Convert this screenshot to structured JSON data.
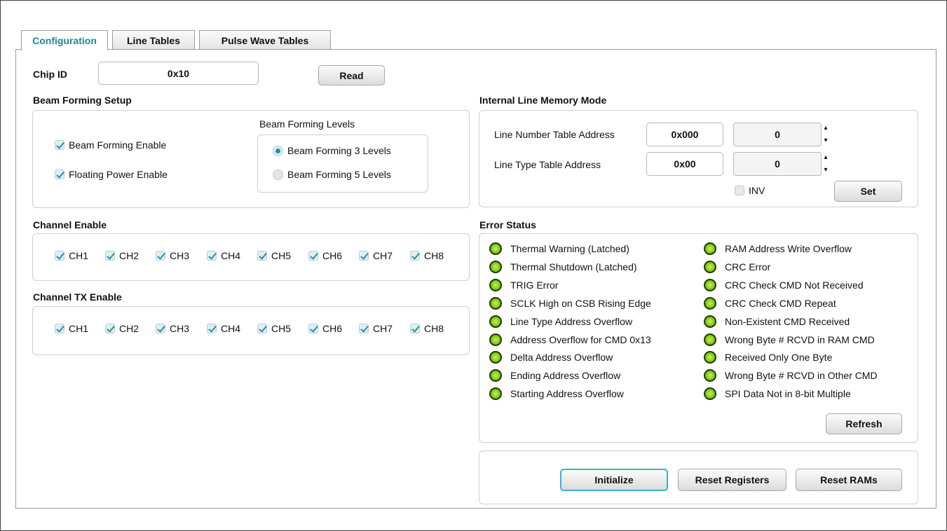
{
  "tabs": [
    {
      "label": "Configuration",
      "active": true
    },
    {
      "label": "Line Tables",
      "active": false
    },
    {
      "label": "Pulse Wave Tables",
      "active": false
    }
  ],
  "chip_id": {
    "label": "Chip ID",
    "value": "0x10",
    "read_button": "Read"
  },
  "beam_forming": {
    "title": "Beam Forming Setup",
    "enable_label": "Beam Forming Enable",
    "enable_checked": true,
    "floating_label": "Floating Power Enable",
    "floating_checked": true,
    "levels_title": "Beam Forming Levels",
    "level3_label": "Beam Forming 3 Levels",
    "level5_label": "Beam Forming 5 Levels",
    "selected_level": "3"
  },
  "channel_enable": {
    "title": "Channel Enable",
    "channels": [
      "CH1",
      "CH2",
      "CH3",
      "CH4",
      "CH5",
      "CH6",
      "CH7",
      "CH8"
    ]
  },
  "channel_tx_enable": {
    "title": "Channel TX Enable",
    "channels": [
      "CH1",
      "CH2",
      "CH3",
      "CH4",
      "CH5",
      "CH6",
      "CH7",
      "CH8"
    ]
  },
  "line_memory": {
    "title": "Internal Line Memory Mode",
    "line_number_label": "Line Number Table Address",
    "line_number_value": "0x000",
    "line_number_spin": "0",
    "line_type_label": "Line Type Table Address",
    "line_type_value": "0x00",
    "line_type_spin": "0",
    "inv_label": "INV",
    "inv_checked": false,
    "set_button": "Set"
  },
  "error_status": {
    "title": "Error Status",
    "led_color": "#8acb1b",
    "left": [
      "Thermal Warning (Latched)",
      "Thermal Shutdown (Latched)",
      "TRIG Error",
      "SCLK High on CSB Rising Edge",
      "Line Type Address Overflow",
      "Address Overflow for CMD 0x13",
      "Delta Address Overflow",
      "Ending Address Overflow",
      "Starting Address Overflow"
    ],
    "right": [
      "RAM Address Write Overflow",
      "CRC Error",
      "CRC Check CMD Not Received",
      "CRC Check CMD Repeat",
      "Non-Existent CMD Received",
      "Wrong Byte # RCVD in RAM CMD",
      "Received Only One Byte",
      "Wrong Byte # RCVD in Other CMD",
      "SPI Data Not in 8-bit Multiple"
    ],
    "refresh_button": "Refresh"
  },
  "actions": {
    "initialize": "Initialize",
    "reset_registers": "Reset Registers",
    "reset_rams": "Reset RAMs"
  },
  "colors": {
    "accent": "#1f8a8a",
    "focus": "#38b4c8",
    "check": "#2a8fa6"
  }
}
